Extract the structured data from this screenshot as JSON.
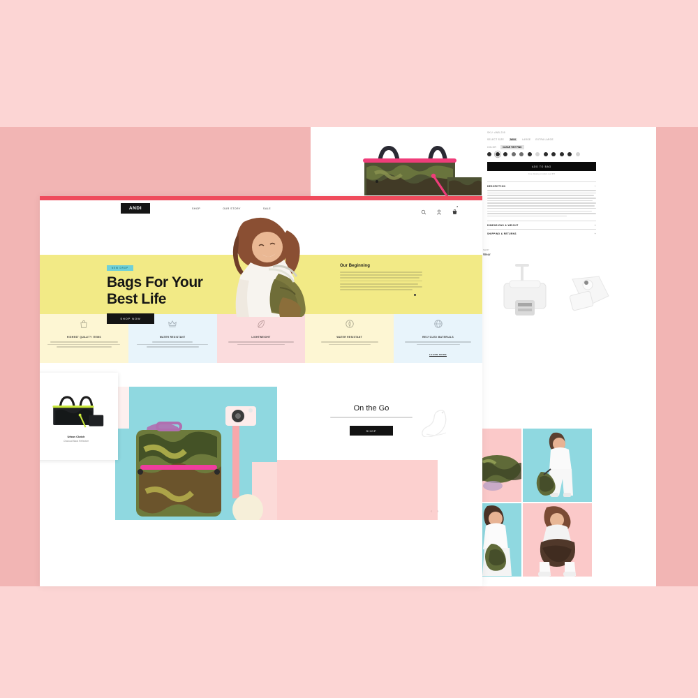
{
  "canvas": {
    "background_color": "#fcd5d4",
    "band_color": "#f2b5b4"
  },
  "left_page": {
    "name": "andi-home-page",
    "topbar_color": "#ef4b5c",
    "brand": {
      "logo_text": "ANDI"
    },
    "nav": {
      "links": [
        "SHOP",
        "OUR STORY",
        "SALE"
      ],
      "icons": [
        "search-icon",
        "account-icon",
        "cart-icon"
      ],
      "cart_badge": "2"
    },
    "hero": {
      "badge": "NEW DROP",
      "headline_line1": "Bags For Your",
      "headline_line2": "Best Life",
      "cta": "SHOP NOW",
      "yellow_color": "#f2ea86",
      "badge_color": "#6fd0d8"
    },
    "our_beginning": {
      "title": "Our Beginning",
      "body_lines": 7
    },
    "features": [
      {
        "title": "HIGHEST QUALITY ITEMS",
        "icon": "bag-icon",
        "bg": "#fdf6d3",
        "body_lines": 3,
        "more": ""
      },
      {
        "title": "WATER RESISTANT",
        "icon": "crown-icon",
        "bg": "#e8f4fb",
        "body_lines": 3,
        "more": ""
      },
      {
        "title": "LIGHTWEIGHT",
        "icon": "feather-icon",
        "bg": "#fbdcdd",
        "body_lines": 2,
        "more": ""
      },
      {
        "title": "WATER RESISTANT",
        "icon": "shield-icon",
        "bg": "#fdf6d3",
        "body_lines": 2,
        "more": ""
      },
      {
        "title": "RECYCLED MATERIALS",
        "icon": "globe-icon",
        "bg": "#e8f4fb",
        "body_lines": 2,
        "more": "LEARN MORE"
      }
    ],
    "product_card": {
      "name": "Urban Clutch",
      "subtitle": "Charcoal Black Reflective",
      "image": "urban-clutch-tote-photo"
    },
    "lifestyle_image": "camo-backpack-cyan-photo",
    "on_the_go": {
      "title": "On the Go",
      "subtitle": "",
      "cta": "SHOP"
    },
    "pink_block_color": "#fcd0cf",
    "carousel_arrows": "‹ ›"
  },
  "right_page": {
    "name": "andi-product-detail-page",
    "sku": "SKU: ANB-205",
    "size": {
      "label": "SELECT SIZE",
      "options": [
        "MINI",
        "LARGE",
        "EXTRA LARGE"
      ],
      "selected": "MINI"
    },
    "color": {
      "label": "COLOR",
      "selected_name": "CLEAR TINT PINK",
      "swatch_count_row1": 8,
      "swatch_count_row2": 4
    },
    "add_to_bag": "ADD TO BAG",
    "note": "Free shipping on orders over $75",
    "accordions": [
      {
        "title": "DESCRIPTION",
        "sign": "−",
        "open": true,
        "body_lines": 11
      },
      {
        "title": "DIMENSIONS & WEIGHT",
        "sign": "+",
        "open": false,
        "body_lines": 0
      },
      {
        "title": "SHIPPING & RETURNS",
        "sign": "+",
        "open": false,
        "body_lines": 0
      }
    ],
    "gallery": {
      "caption_small": "SHOP",
      "caption_large": "Wear",
      "items": [
        "bag-diagram-illustration",
        "bag-tag-illustration"
      ]
    },
    "image_grid": [
      {
        "bg": "#fbc9c9",
        "alt": "camo-duffel-photo"
      },
      {
        "bg": "#8fd8e0",
        "alt": "woman-with-duffel-photo"
      },
      {
        "bg": "#8fd8e0",
        "alt": "woman-with-camo-bag-photo"
      },
      {
        "bg": "#fbc9c9",
        "alt": "woman-seated-with-bag-photo"
      }
    ]
  },
  "top_product_image": {
    "name": "camo-tote-pink-trim-photo"
  }
}
